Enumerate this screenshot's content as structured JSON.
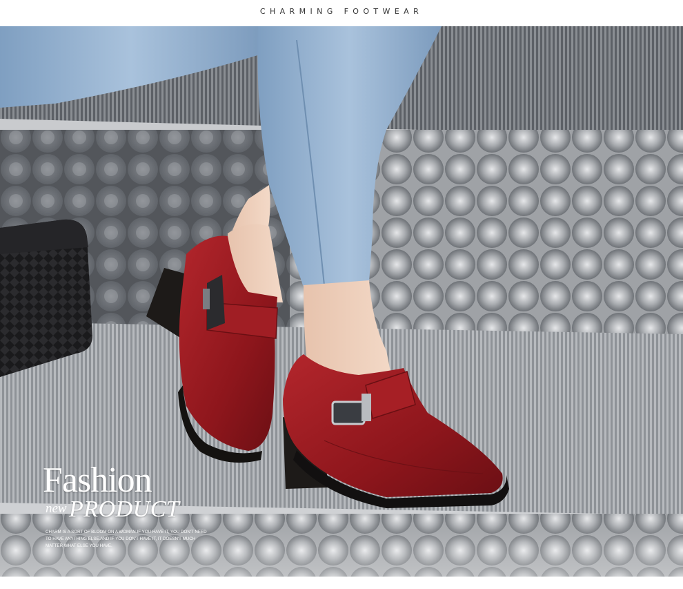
{
  "header": {
    "tagline": "CHARMING FOOTWEAR"
  },
  "overlay": {
    "headline": "Fashion",
    "sub_small": "new",
    "sub_large": "PRODUCT",
    "blurb": "CHARM IS A SORT OF BLOOM ON A WOMAN.IF YOU HAVE IT, YOU DON'T NEED TO HAVE ANYTHING ELSE.AND IF YOU DON'T HAVE IT, IT DOESN'T MUCH MATTER WHAT ELSE YOU HAVE."
  },
  "colors": {
    "shoe_red": "#9a1c22",
    "denim": "#8fb0d0",
    "step_metal": "#9ea2a7",
    "bag_black": "#1c1c1e"
  }
}
